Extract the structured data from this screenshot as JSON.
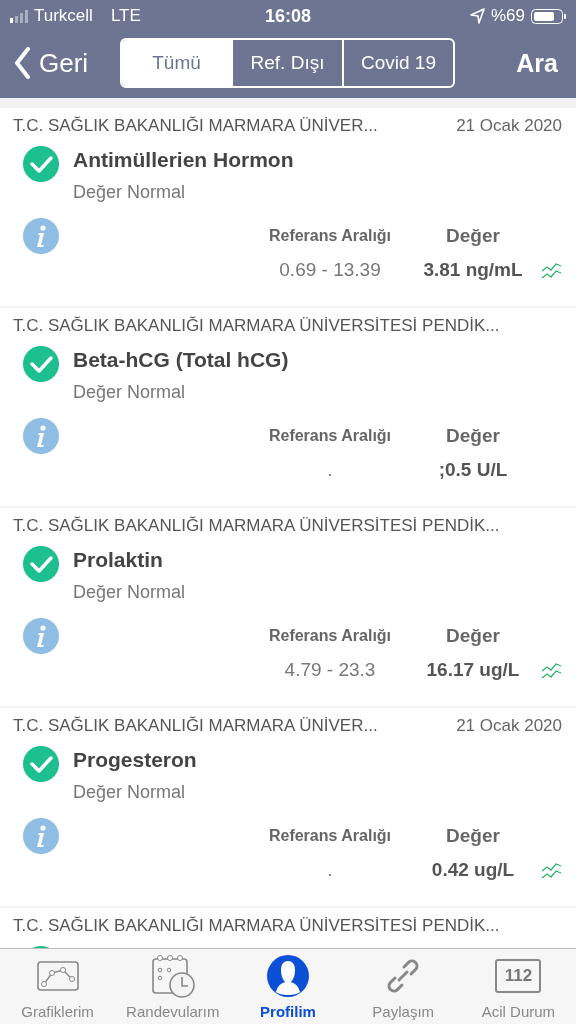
{
  "status_bar": {
    "carrier": "Turkcell",
    "network": "LTE",
    "time": "16:08",
    "battery": "%69"
  },
  "nav": {
    "back": "Geri",
    "action": "Ara",
    "segments": [
      {
        "label": "Tümü",
        "selected": true
      },
      {
        "label": "Ref. Dışı",
        "selected": false
      },
      {
        "label": "Covid 19",
        "selected": false
      }
    ]
  },
  "results": [
    {
      "institution": "T.C. SAĞLIK BAKANLIĞI MARMARA ÜNİVER...",
      "date": "21 Ocak 2020",
      "test": "Antimüllerien Hormon",
      "status": "Değer Normal",
      "normal": true,
      "reference_label": "Referans Aralığı",
      "value_label": "Değer",
      "reference": "0.69 - 13.39",
      "value": "3.81 ng/mL",
      "trend": true
    },
    {
      "institution": "T.C. SAĞLIK BAKANLIĞI MARMARA ÜNİVERSİTESİ PENDİK...",
      "test": "Beta-hCG (Total hCG)",
      "status": "Değer Normal",
      "normal": true,
      "reference_label": "Referans Aralığı",
      "value_label": "Değer",
      "reference": ".",
      "value": ";0.5 U/L",
      "trend": false
    },
    {
      "institution": "T.C. SAĞLIK BAKANLIĞI MARMARA ÜNİVERSİTESİ PENDİK...",
      "test": "Prolaktin",
      "status": "Değer Normal",
      "normal": true,
      "reference_label": "Referans Aralığı",
      "value_label": "Değer",
      "reference": "4.79 - 23.3",
      "value": "16.17 ug/L",
      "trend": true
    },
    {
      "institution": "T.C. SAĞLIK BAKANLIĞI MARMARA ÜNİVER...",
      "date": "21 Ocak 2020",
      "test": "Progesteron",
      "status": "Değer Normal",
      "normal": true,
      "reference_label": "Referans Aralığı",
      "value_label": "Değer",
      "reference": ".",
      "value": "0.42 ug/L",
      "trend": true
    },
    {
      "institution": "T.C. SAĞLIK BAKANLIĞI MARMARA ÜNİVERSİTESİ PENDİK...",
      "normal": true
    }
  ],
  "tab_bar": [
    {
      "label": "Grafiklerim",
      "kind": "chart",
      "selected": false
    },
    {
      "label": "Randevularım",
      "kind": "calendar",
      "selected": false
    },
    {
      "label": "Profilim",
      "kind": "profile",
      "selected": true
    },
    {
      "label": "Paylaşım",
      "kind": "link",
      "selected": false
    },
    {
      "label": "Acil Durum",
      "kind": "emergency",
      "badge": "112",
      "selected": false
    }
  ]
}
